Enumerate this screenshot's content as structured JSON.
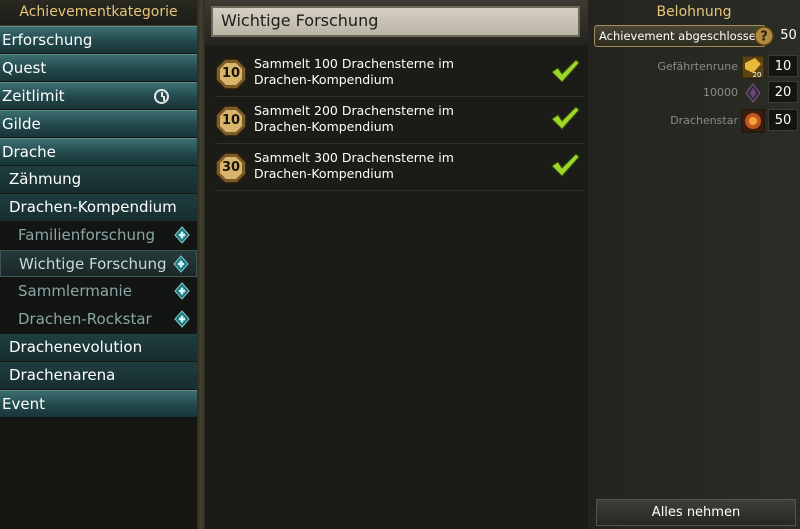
{
  "sidebar": {
    "title": "Achievementkategorie",
    "items": [
      {
        "label": "Erforschung"
      },
      {
        "label": "Quest"
      },
      {
        "label": "Zeitlimit"
      },
      {
        "label": "Gilde"
      },
      {
        "label": "Drache"
      },
      {
        "label": "Zähmung"
      },
      {
        "label": "Drachen-Kompendium"
      },
      {
        "label": "Familienforschung"
      },
      {
        "label": "Wichtige Forschung"
      },
      {
        "label": "Sammlermanie"
      },
      {
        "label": "Drachen-Rockstar"
      },
      {
        "label": "Drachenevolution"
      },
      {
        "label": "Drachenarena"
      },
      {
        "label": "Event"
      }
    ]
  },
  "main": {
    "title": "Wichtige Forschung",
    "achievements": [
      {
        "points": "10",
        "text": "Sammelt 100 Drachensterne im Drachen-Kompendium"
      },
      {
        "points": "10",
        "text": "Sammelt 200 Drachensterne im Drachen-Kompendium"
      },
      {
        "points": "30",
        "text": "Sammelt 300 Drachensterne im Drachen-Kompendium"
      }
    ]
  },
  "reward": {
    "title": "Belohnung",
    "complete_label": "Achievement abgeschlossen",
    "complete_value": "50",
    "items": [
      {
        "name": "Gefährtenrune",
        "icon_badge": "20",
        "value": "10"
      },
      {
        "name": "10000",
        "value": "20"
      },
      {
        "name": "Drachenstar",
        "value": "50"
      }
    ],
    "take_all_label": "Alles nehmen"
  },
  "colors": {
    "accent_gold": "#e7c57a",
    "category_teal": "#2f5d60",
    "check_green": "#9fd62a"
  }
}
